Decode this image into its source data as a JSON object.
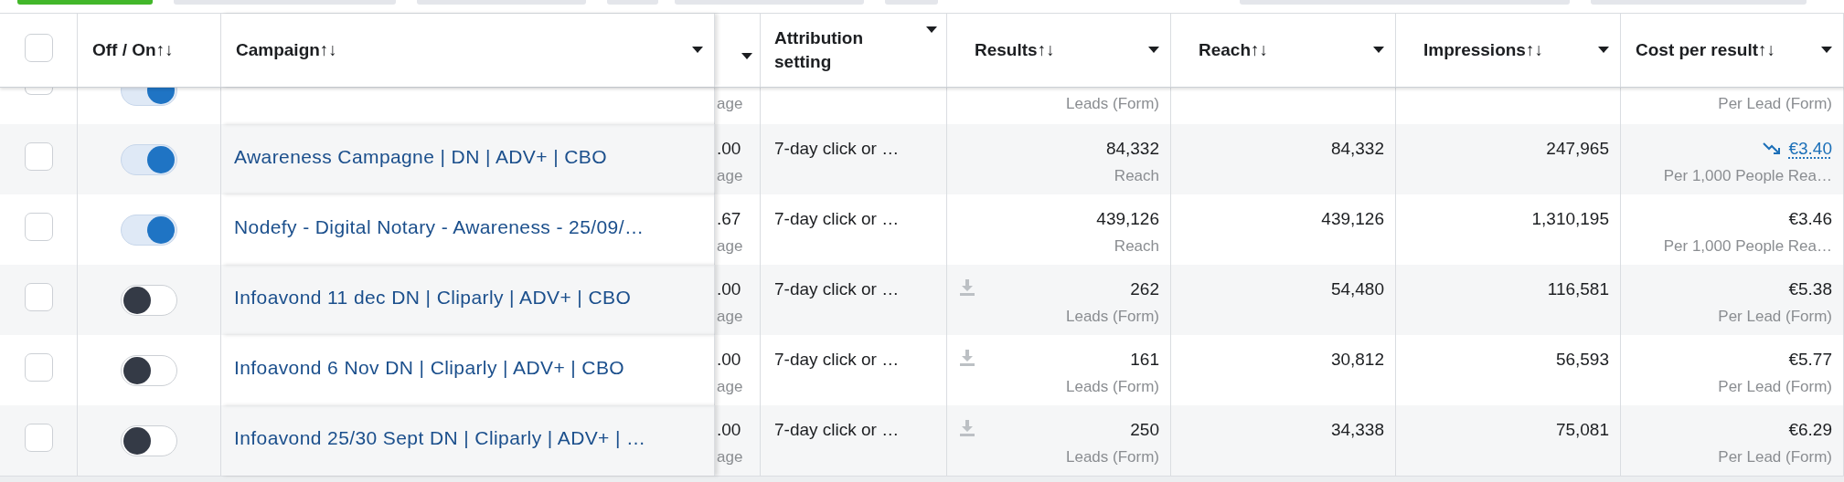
{
  "toolbar": {
    "buttons": [
      {
        "kind": "primary"
      },
      {
        "kind": "secondary"
      },
      {
        "kind": "secondary"
      },
      {
        "kind": "secondary"
      },
      {
        "kind": "secondary"
      },
      {
        "kind": "secondary"
      },
      {
        "kind": "secondary"
      },
      {
        "kind": "secondary"
      }
    ]
  },
  "table": {
    "select_all": {
      "checked": false
    },
    "columns": [
      {
        "kind": "toggle",
        "label": "Off / On",
        "sort": "↑↓",
        "menu": false
      },
      {
        "kind": "campaign",
        "label": "Campaign",
        "sort": "↑↓",
        "menu": true
      },
      {
        "kind": "column_4",
        "menu": true
      },
      {
        "kind": "attribution",
        "label": "Attribution setting",
        "menu": true
      },
      {
        "kind": "results",
        "label": "Results",
        "sort": "↑↓",
        "menu": true
      },
      {
        "kind": "reach",
        "label": "Reach",
        "sort": "↑↓",
        "menu": true
      },
      {
        "kind": "impressions",
        "label": "Impressions",
        "sort": "↑↓",
        "menu": true
      },
      {
        "kind": "cost",
        "label": "Cost per result",
        "sort": "↑↓",
        "menu": true
      }
    ],
    "rows": [
      {
        "kind": "cut_off",
        "checked": false,
        "on": true,
        "column_4": {
          "sub": "age"
        },
        "results": {
          "sub": "Leads (Form)"
        },
        "cost": {
          "sub": "Per Lead (Form)"
        }
      },
      {
        "kind": "full",
        "checked": false,
        "on": true,
        "campaign": "Awareness Campagne | DN | ADV+ | CBO",
        "column_4": {
          "value": ".00",
          "sub": "age"
        },
        "attribution": "7-day click or …",
        "results": {
          "value": "84,332",
          "sub": "Reach",
          "icon": false
        },
        "reach": "84,332",
        "impressions": "247,965",
        "cost": {
          "value": "€3.40",
          "sub": "Per 1,000 People Rea…",
          "trending_down": true,
          "link": true
        }
      },
      {
        "kind": "full",
        "checked": false,
        "on": true,
        "campaign": "Nodefy - Digital Notary - Awareness - 25/09/…",
        "column_4": {
          "value": ".67",
          "sub": "age"
        },
        "attribution": "7-day click or …",
        "results": {
          "value": "439,126",
          "sub": "Reach",
          "icon": false
        },
        "reach": "439,126",
        "impressions": "1,310,195",
        "cost": {
          "value": "€3.46",
          "sub": "Per 1,000 People Rea…",
          "trending_down": false,
          "link": false
        }
      },
      {
        "kind": "full",
        "checked": false,
        "on": false,
        "campaign": "Infoavond 11 dec DN | Cliparly | ADV+ | CBO",
        "column_4": {
          "value": ".00",
          "sub": "age"
        },
        "attribution": "7-day click or …",
        "results": {
          "value": "262",
          "sub": "Leads (Form)",
          "icon": true
        },
        "reach": "54,480",
        "impressions": "116,581",
        "cost": {
          "value": "€5.38",
          "sub": "Per Lead (Form)",
          "trending_down": false,
          "link": false
        }
      },
      {
        "kind": "full",
        "checked": false,
        "on": false,
        "campaign": "Infoavond 6 Nov DN | Cliparly | ADV+ | CBO",
        "column_4": {
          "value": ".00",
          "sub": "age"
        },
        "attribution": "7-day click or …",
        "results": {
          "value": "161",
          "sub": "Leads (Form)",
          "icon": true
        },
        "reach": "30,812",
        "impressions": "56,593",
        "cost": {
          "value": "€5.77",
          "sub": "Per Lead (Form)",
          "trending_down": false,
          "link": false
        }
      },
      {
        "kind": "full",
        "checked": false,
        "on": false,
        "campaign": "Infoavond 25/30 Sept DN | Cliparly | ADV+ | …",
        "column_4": {
          "value": ".00",
          "sub": "age"
        },
        "attribution": "7-day click or …",
        "results": {
          "value": "250",
          "sub": "Leads (Form)",
          "icon": true
        },
        "reach": "34,338",
        "impressions": "75,081",
        "cost": {
          "value": "€6.29",
          "sub": "Per Lead (Form)",
          "trending_down": false,
          "link": false
        }
      }
    ]
  }
}
